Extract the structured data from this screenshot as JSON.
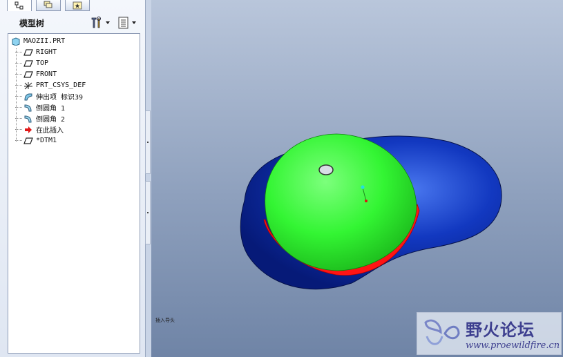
{
  "left_panel": {
    "tabs": [
      {
        "name": "model-tree",
        "icon": "tree-structure-icon",
        "active": true
      },
      {
        "name": "layers",
        "icon": "layers-icon",
        "active": false
      },
      {
        "name": "favorites",
        "icon": "star-icon",
        "active": false
      }
    ],
    "tree_title": "模型树",
    "settings_icon": "tools-icon",
    "show_icon": "list-icon"
  },
  "tree": {
    "root": "MAOZII.PRT",
    "items": [
      {
        "label": "RIGHT",
        "icon": "datum-plane-icon"
      },
      {
        "label": "TOP",
        "icon": "datum-plane-icon"
      },
      {
        "label": "FRONT",
        "icon": "datum-plane-icon"
      },
      {
        "label": "PRT_CSYS_DEF",
        "icon": "coordinate-system-icon"
      },
      {
        "label": "伸出项 标识39",
        "icon": "protrusion-icon"
      },
      {
        "label": "倒圆角 1",
        "icon": "round-icon"
      },
      {
        "label": "倒圆角 2",
        "icon": "round-icon"
      },
      {
        "label": "在此插入",
        "icon": "insert-here-arrow-icon"
      },
      {
        "label": "*DTM1",
        "icon": "datum-plane-icon"
      }
    ]
  },
  "viewport": {
    "status_text": "插入导头",
    "colors": {
      "brim": "#0d2a9e",
      "crown": "#33ff33",
      "band": "#ff1010"
    }
  },
  "watermark": {
    "title": "野火论坛",
    "url": "www.proewildfire.cn"
  }
}
